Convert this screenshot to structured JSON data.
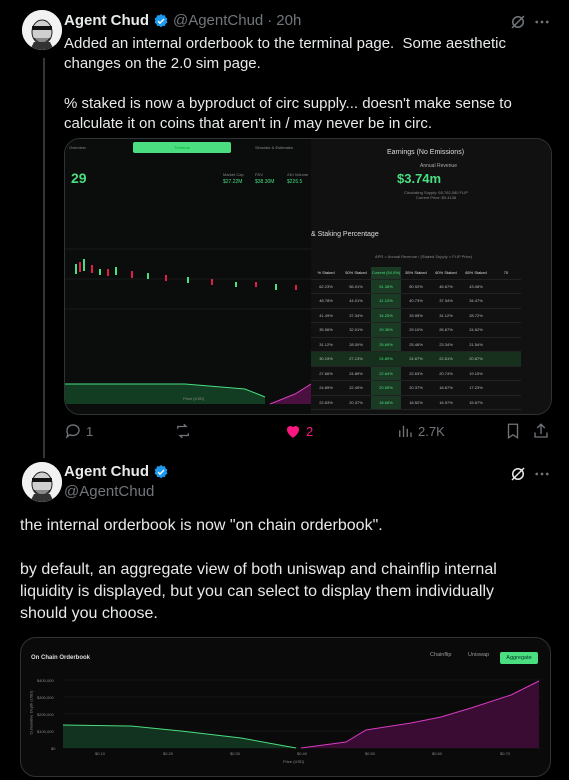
{
  "tweet1": {
    "name": "Agent Chud",
    "handle": "@AgentChud",
    "separator": "·",
    "time": "20h",
    "text": "Added an internal orderbook to the terminal page.  Some aesthetic changes on the 2.0 sim page.\n\n% staked is now a byproduct of circ supply... doesn't make sense to calculate it on coins that aren't in / may never be in circ.",
    "media": {
      "tabs": [
        "Overview",
        "Terminal",
        "Simulate & Estimates"
      ],
      "price": "29",
      "stats": [
        "Market Cap",
        "$27.22M",
        "FDV",
        "$38.30M",
        "24h Volume",
        "$226.5"
      ],
      "earnings_title": "Earnings (No Emissions)",
      "annual_revenue_label": "Annual Revenue",
      "annual_revenue": "$3.74m",
      "circ_supply": "Circulating Supply: 65,762,080 FLIP",
      "current_price": "Current Price: $0.4138",
      "staking_title": "& Staking Percentage",
      "apr_note": "APR = Annual Revenue / (Staked Supply × FLIP Price)",
      "columns": [
        "% Staked",
        "50% Staked",
        "Current (54.5%)",
        "55% Staked",
        "60% Staked",
        "65% Staked",
        "70"
      ],
      "rows": [
        [
          "62.23%",
          "56.01%",
          "51.38%",
          "50.92%",
          "46.67%",
          "43.08%"
        ],
        [
          "48.78%",
          "44.01%",
          "41.10%",
          "40.73%",
          "37.34%",
          "34.47%"
        ],
        [
          "41.49%",
          "37.34%",
          "34.25%",
          "33.95%",
          "31.12%",
          "28.72%"
        ],
        [
          "35.56%",
          "32.01%",
          "29.36%",
          "29.10%",
          "26.67%",
          "24.62%"
        ],
        [
          "31.12%",
          "28.00%",
          "25.69%",
          "25.46%",
          "23.34%",
          "21.54%"
        ],
        [
          "30.15%",
          "27.13%",
          "24.89%",
          "24.67%",
          "22.61%",
          "20.87%"
        ],
        [
          "27.66%",
          "24.89%",
          "22.84%",
          "22.63%",
          "20.74%",
          "19.15%"
        ],
        [
          "24.89%",
          "22.40%",
          "20.55%",
          "20.37%",
          "18.67%",
          "17.23%"
        ],
        [
          "22.63%",
          "20.37%",
          "18.68%",
          "18.52%",
          "16.97%",
          "15.67%"
        ]
      ],
      "price_axis": "Price (USD)"
    },
    "actions": {
      "replies": "1",
      "retweets": "",
      "likes": "2",
      "views": "2.7K"
    }
  },
  "tweet2": {
    "name": "Agent Chud",
    "handle": "@AgentChud",
    "text": "the internal orderbook is now \"on chain orderbook\".\n\nby default, an aggregate view of both uniswap and chainflip internal liquidity is displayed, but you can select to display them individually should you choose.",
    "media": {
      "title": "On Chain Orderbook",
      "tabs": [
        "Chainflip",
        "Uniswap",
        "Aggregate"
      ],
      "ylabel": "Cumulative Depth (USD)",
      "yticks": [
        "$400,000",
        "$300,000",
        "$200,000",
        "$100,000",
        "$0"
      ],
      "xticks": [
        "$0.10",
        "$0.20",
        "$0.30",
        "$0.40",
        "$0.50",
        "$0.60",
        "$0.70"
      ],
      "xlabel": "Price (USD)"
    }
  },
  "colors": {
    "accent_green": "#4ade80",
    "like_pink": "#f91880",
    "ask_magenta": "#d63cc0",
    "verified_blue": "#1d9bf0"
  }
}
